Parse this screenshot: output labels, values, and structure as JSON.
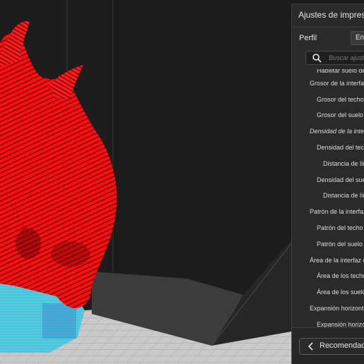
{
  "panel": {
    "title": "Ajustes de impresión",
    "profile_label": "Perfil",
    "profile_value": "En",
    "search_placeholder": "Buscar ajustes",
    "items": [
      {
        "label": "Habilitar suelo de",
        "indent": 1,
        "italic": false
      },
      {
        "label": "Grosor de la interfaz",
        "indent": 0,
        "italic": false
      },
      {
        "label": "Grosor del techo d",
        "indent": 1,
        "italic": false
      },
      {
        "label": "Grosor del suelo d",
        "indent": 1,
        "italic": false
      },
      {
        "label": "Densidad de la interfaz",
        "indent": 0,
        "italic": true
      },
      {
        "label": "Densidad del techo",
        "indent": 1,
        "italic": false
      },
      {
        "label": "Distancia de lín",
        "indent": 2,
        "italic": false
      },
      {
        "label": "Densidad del suelo",
        "indent": 1,
        "italic": false
      },
      {
        "label": "Distancia de lín",
        "indent": 2,
        "italic": false
      },
      {
        "label": "Patrón de la interfaz",
        "indent": 0,
        "italic": false
      },
      {
        "label": "Patrón del techo d",
        "indent": 1,
        "italic": false
      },
      {
        "label": "Patrón del suelo d",
        "indent": 1,
        "italic": false
      },
      {
        "label": "Área de la interfaz de",
        "indent": 0,
        "italic": false
      },
      {
        "label": "Área de los techos",
        "indent": 1,
        "italic": false
      },
      {
        "label": "Área de los suelos",
        "indent": 1,
        "italic": false
      },
      {
        "label": "Expansión horizonta",
        "indent": 0,
        "italic": false
      },
      {
        "label": "Expansión horizon",
        "indent": 1,
        "italic": false
      }
    ],
    "recommended_button": "Recomendado"
  },
  "colors": {
    "model_red": "#ff0d0d",
    "support_cyan": "#3fd0d8",
    "panel_bg": "#2a2a2b",
    "build_plate": "#c8c8c8"
  }
}
